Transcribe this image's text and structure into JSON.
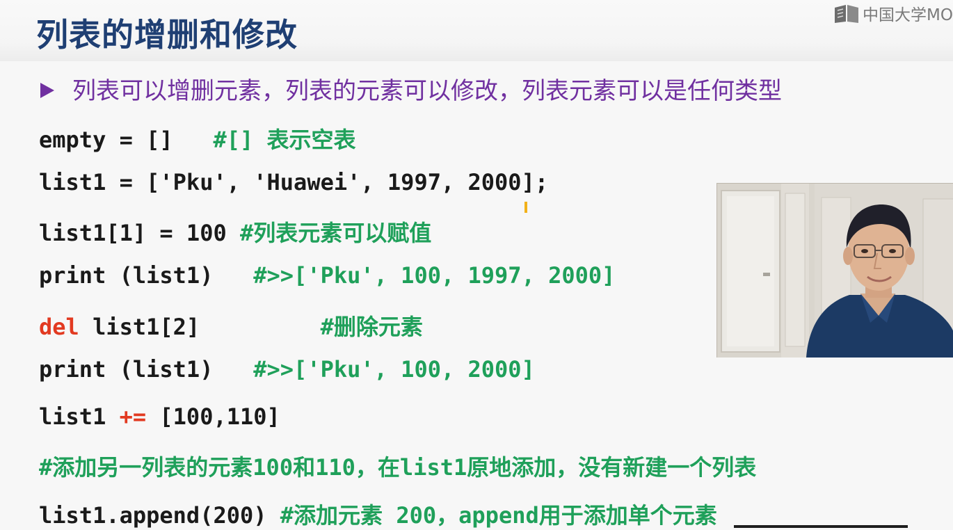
{
  "slide": {
    "title": "列表的增删和修改",
    "watermark": "中国大学MO",
    "bullet": "列表可以增删元素，列表的元素可以修改，列表元素可以是任何类型"
  },
  "code": {
    "line1": {
      "code": "empty = []   ",
      "comment": "#[] ",
      "comment_cn": "表示空表"
    },
    "line2": {
      "code": "list1 = ['Pku', 'Huawei', 1997, 2000];"
    },
    "line3": {
      "code": "list1[1] = 100 ",
      "comment": "#",
      "comment_cn": "列表元素可以赋值"
    },
    "line4": {
      "code": "print (list1)   ",
      "comment": "#>>['Pku', 100, 1997, 2000]"
    },
    "line5": {
      "keyword": "del",
      "code": " list1[2]         ",
      "comment": "#",
      "comment_cn": "删除元素"
    },
    "line6": {
      "code": "print (list1)   ",
      "comment": "#>>['Pku', 100, 2000]"
    },
    "line7": {
      "code_a": "list1 ",
      "operator": "+=",
      "code_b": " [100,110]"
    },
    "line8": {
      "p1": "#",
      "p2": "添加另一列表的元素",
      "p3": "100",
      "p4": "和",
      "p5": "110",
      "p6": "，在",
      "p7": "list1",
      "p8": "原地添加，没有新建一个列表"
    },
    "line9": {
      "code": "list1.append(200) ",
      "p1": "#",
      "p2": "添加元素",
      "p3": " 200",
      "p4": "，",
      "p5": "append",
      "p6": "用于添加单个元素"
    }
  },
  "colors": {
    "title": "#1f3f73",
    "bullet": "#7030a0",
    "code": "#1a1a1a",
    "comment": "#1fa05a",
    "keyword": "#e23a21"
  },
  "icons": [
    "mooc-logo-icon",
    "bullet-arrow-icon"
  ]
}
